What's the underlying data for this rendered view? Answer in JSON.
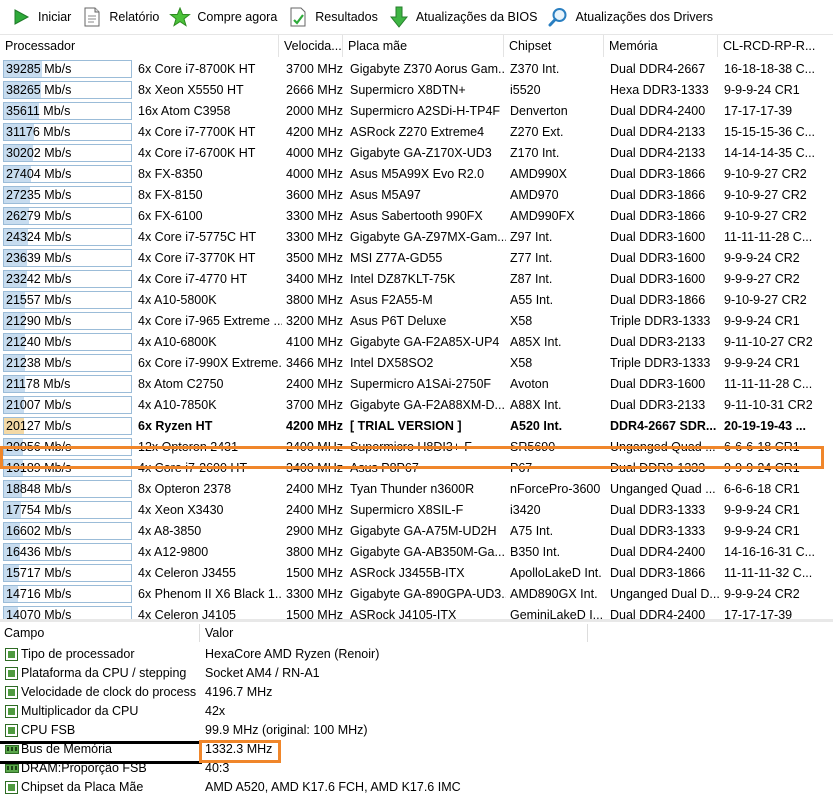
{
  "toolbar": {
    "items": [
      {
        "label": "Iniciar",
        "icon": "play-icon"
      },
      {
        "label": "Relatório",
        "icon": "report-icon"
      },
      {
        "label": "Compre agora",
        "icon": "star-icon"
      },
      {
        "label": "Resultados",
        "icon": "results-icon"
      },
      {
        "label": "Atualizações da BIOS",
        "icon": "download-arrow-icon"
      },
      {
        "label": "Atualizações dos Drivers",
        "icon": "search-icon"
      }
    ]
  },
  "grid": {
    "columns": [
      "Processador",
      "Velocida...",
      "Placa mãe",
      "Chipset",
      "Memória",
      "CL-RCD-RP-R..."
    ],
    "max_value": 39285,
    "rows": [
      {
        "value": 39285,
        "result": "39285 Mb/s",
        "cpu": "6x Core i7-8700K HT",
        "clock": "3700 MHz",
        "board": "Gigabyte Z370 Aorus Gam...",
        "chipset": "Z370 Int.",
        "memory": "Dual DDR4-2667",
        "timing": "16-18-18-38 C..."
      },
      {
        "value": 38265,
        "result": "38265 Mb/s",
        "cpu": "8x Xeon X5550 HT",
        "clock": "2666 MHz",
        "board": "Supermicro X8DTN+",
        "chipset": "i5520",
        "memory": "Hexa DDR3-1333",
        "timing": "9-9-9-24 CR1"
      },
      {
        "value": 35611,
        "result": "35611 Mb/s",
        "cpu": "16x Atom C3958",
        "clock": "2000 MHz",
        "board": "Supermicro A2SDi-H-TP4F",
        "chipset": "Denverton",
        "memory": "Dual DDR4-2400",
        "timing": "17-17-17-39"
      },
      {
        "value": 31176,
        "result": "31176 Mb/s",
        "cpu": "4x Core i7-7700K HT",
        "clock": "4200 MHz",
        "board": "ASRock Z270 Extreme4",
        "chipset": "Z270 Ext.",
        "memory": "Dual DDR4-2133",
        "timing": "15-15-15-36 C..."
      },
      {
        "value": 30202,
        "result": "30202 Mb/s",
        "cpu": "4x Core i7-6700K HT",
        "clock": "4000 MHz",
        "board": "Gigabyte GA-Z170X-UD3",
        "chipset": "Z170 Int.",
        "memory": "Dual DDR4-2133",
        "timing": "14-14-14-35 C..."
      },
      {
        "value": 27404,
        "result": "27404 Mb/s",
        "cpu": "8x FX-8350",
        "clock": "4000 MHz",
        "board": "Asus M5A99X Evo R2.0",
        "chipset": "AMD990X",
        "memory": "Dual DDR3-1866",
        "timing": "9-10-9-27 CR2"
      },
      {
        "value": 27235,
        "result": "27235 Mb/s",
        "cpu": "8x FX-8150",
        "clock": "3600 MHz",
        "board": "Asus M5A97",
        "chipset": "AMD970",
        "memory": "Dual DDR3-1866",
        "timing": "9-10-9-27 CR2"
      },
      {
        "value": 26279,
        "result": "26279 Mb/s",
        "cpu": "6x FX-6100",
        "clock": "3300 MHz",
        "board": "Asus Sabertooth 990FX",
        "chipset": "AMD990FX",
        "memory": "Dual DDR3-1866",
        "timing": "9-10-9-27 CR2"
      },
      {
        "value": 24324,
        "result": "24324 Mb/s",
        "cpu": "4x Core i7-5775C HT",
        "clock": "3300 MHz",
        "board": "Gigabyte GA-Z97MX-Gam...",
        "chipset": "Z97 Int.",
        "memory": "Dual DDR3-1600",
        "timing": "11-11-11-28 C..."
      },
      {
        "value": 23639,
        "result": "23639 Mb/s",
        "cpu": "4x Core i7-3770K HT",
        "clock": "3500 MHz",
        "board": "MSI Z77A-GD55",
        "chipset": "Z77 Int.",
        "memory": "Dual DDR3-1600",
        "timing": "9-9-9-24 CR2"
      },
      {
        "value": 23242,
        "result": "23242 Mb/s",
        "cpu": "4x Core i7-4770 HT",
        "clock": "3400 MHz",
        "board": "Intel DZ87KLT-75K",
        "chipset": "Z87 Int.",
        "memory": "Dual DDR3-1600",
        "timing": "9-9-9-27 CR2"
      },
      {
        "value": 21557,
        "result": "21557 Mb/s",
        "cpu": "4x A10-5800K",
        "clock": "3800 MHz",
        "board": "Asus F2A55-M",
        "chipset": "A55 Int.",
        "memory": "Dual DDR3-1866",
        "timing": "9-10-9-27 CR2"
      },
      {
        "value": 21290,
        "result": "21290 Mb/s",
        "cpu": "4x Core i7-965 Extreme ...",
        "clock": "3200 MHz",
        "board": "Asus P6T Deluxe",
        "chipset": "X58",
        "memory": "Triple DDR3-1333",
        "timing": "9-9-9-24 CR1"
      },
      {
        "value": 21240,
        "result": "21240 Mb/s",
        "cpu": "4x A10-6800K",
        "clock": "4100 MHz",
        "board": "Gigabyte GA-F2A85X-UP4",
        "chipset": "A85X Int.",
        "memory": "Dual DDR3-2133",
        "timing": "9-11-10-27 CR2"
      },
      {
        "value": 21238,
        "result": "21238 Mb/s",
        "cpu": "6x Core i7-990X Extreme...",
        "clock": "3466 MHz",
        "board": "Intel DX58SO2",
        "chipset": "X58",
        "memory": "Triple DDR3-1333",
        "timing": "9-9-9-24 CR1"
      },
      {
        "value": 21178,
        "result": "21178 Mb/s",
        "cpu": "8x Atom C2750",
        "clock": "2400 MHz",
        "board": "Supermicro A1SAi-2750F",
        "chipset": "Avoton",
        "memory": "Dual DDR3-1600",
        "timing": "11-11-11-28 C..."
      },
      {
        "value": 21007,
        "result": "21007 Mb/s",
        "cpu": "4x A10-7850K",
        "clock": "3700 MHz",
        "board": "Gigabyte GA-F2A88XM-D...",
        "chipset": "A88X Int.",
        "memory": "Dual DDR3-2133",
        "timing": "9-11-10-31 CR2"
      },
      {
        "value": 20127,
        "result": "20127 Mb/s",
        "cpu": "6x Ryzen HT",
        "clock": "4200 MHz",
        "board": "[ TRIAL VERSION ]",
        "chipset": "A520 Int.",
        "memory": "DDR4-2667 SDR...",
        "timing": "20-19-19-43 ...",
        "highlight": true
      },
      {
        "value": 20056,
        "result": "20056 Mb/s",
        "cpu": "12x Opteron 2431",
        "clock": "2400 MHz",
        "board": "Supermicro H8DI3+-F",
        "chipset": "SR5690",
        "memory": "Unganged Quad ...",
        "timing": "6-6-6-18 CR1"
      },
      {
        "value": 19189,
        "result": "19189 Mb/s",
        "cpu": "4x Core i7-2600 HT",
        "clock": "3400 MHz",
        "board": "Asus P8P67",
        "chipset": "P67",
        "memory": "Dual DDR3-1333",
        "timing": "9-9-9-24 CR1"
      },
      {
        "value": 18848,
        "result": "18848 Mb/s",
        "cpu": "8x Opteron 2378",
        "clock": "2400 MHz",
        "board": "Tyan Thunder n3600R",
        "chipset": "nForcePro-3600",
        "memory": "Unganged Quad ...",
        "timing": "6-6-6-18 CR1"
      },
      {
        "value": 17754,
        "result": "17754 Mb/s",
        "cpu": "4x Xeon X3430",
        "clock": "2400 MHz",
        "board": "Supermicro X8SIL-F",
        "chipset": "i3420",
        "memory": "Dual DDR3-1333",
        "timing": "9-9-9-24 CR1"
      },
      {
        "value": 16602,
        "result": "16602 Mb/s",
        "cpu": "4x A8-3850",
        "clock": "2900 MHz",
        "board": "Gigabyte GA-A75M-UD2H",
        "chipset": "A75 Int.",
        "memory": "Dual DDR3-1333",
        "timing": "9-9-9-24 CR1"
      },
      {
        "value": 16436,
        "result": "16436 Mb/s",
        "cpu": "4x A12-9800",
        "clock": "3800 MHz",
        "board": "Gigabyte GA-AB350M-Ga...",
        "chipset": "B350 Int.",
        "memory": "Dual DDR4-2400",
        "timing": "14-16-16-31 C..."
      },
      {
        "value": 15717,
        "result": "15717 Mb/s",
        "cpu": "4x Celeron J3455",
        "clock": "1500 MHz",
        "board": "ASRock J3455B-ITX",
        "chipset": "ApolloLakeD Int.",
        "memory": "Dual DDR3-1866",
        "timing": "11-11-11-32 C..."
      },
      {
        "value": 14716,
        "result": "14716 Mb/s",
        "cpu": "6x Phenom II X6 Black 1...",
        "clock": "3300 MHz",
        "board": "Gigabyte GA-890GPA-UD3...",
        "chipset": "AMD890GX Int.",
        "memory": "Unganged Dual D...",
        "timing": "9-9-9-24 CR2"
      },
      {
        "value": 14070,
        "result": "14070 Mb/s",
        "cpu": "4x Celeron J4105",
        "clock": "1500 MHz",
        "board": "ASRock J4105-ITX",
        "chipset": "GeminiLakeD I...",
        "memory": "Dual DDR4-2400",
        "timing": "17-17-17-39"
      }
    ]
  },
  "details": {
    "header_field": "Campo",
    "header_value": "Valor",
    "rows": [
      {
        "field": "Tipo de processador",
        "value": "HexaCore AMD Ryzen  (Renoir)"
      },
      {
        "field": "Plataforma da CPU / stepping",
        "value": "Socket AM4 / RN-A1"
      },
      {
        "field": "Velocidade de clock do process...",
        "value": "4196.7 MHz"
      },
      {
        "field": "Multiplicador da CPU",
        "value": "42x"
      },
      {
        "field": "CPU FSB",
        "value": "99.9 MHz  (original: 100 MHz)"
      },
      {
        "field": "Bus de Memória",
        "value": "1332.3 MHz"
      },
      {
        "field": "DRAM:Proporção FSB",
        "value": "40:3"
      },
      {
        "field": "Chipset da Placa Mãe",
        "value": "AMD A520, AMD K17.6 FCH, AMD K17.6 IMC"
      }
    ]
  },
  "colors": {
    "highlight_outline": "#f0862a",
    "bar_fill": "#c7dcef",
    "bar_fill_highlight": "#f3d9a6",
    "icon_green": "#3fa535"
  }
}
